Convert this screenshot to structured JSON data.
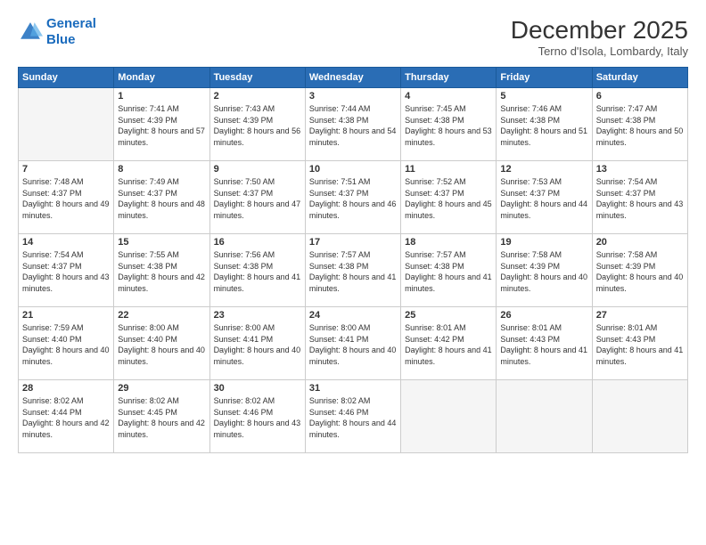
{
  "logo": {
    "line1": "General",
    "line2": "Blue"
  },
  "title": "December 2025",
  "location": "Terno d'Isola, Lombardy, Italy",
  "weekdays": [
    "Sunday",
    "Monday",
    "Tuesday",
    "Wednesday",
    "Thursday",
    "Friday",
    "Saturday"
  ],
  "weeks": [
    [
      {
        "day": "",
        "empty": true
      },
      {
        "day": "1",
        "sunrise": "7:41 AM",
        "sunset": "4:39 PM",
        "daylight": "8 hours and 57 minutes."
      },
      {
        "day": "2",
        "sunrise": "7:43 AM",
        "sunset": "4:39 PM",
        "daylight": "8 hours and 56 minutes."
      },
      {
        "day": "3",
        "sunrise": "7:44 AM",
        "sunset": "4:38 PM",
        "daylight": "8 hours and 54 minutes."
      },
      {
        "day": "4",
        "sunrise": "7:45 AM",
        "sunset": "4:38 PM",
        "daylight": "8 hours and 53 minutes."
      },
      {
        "day": "5",
        "sunrise": "7:46 AM",
        "sunset": "4:38 PM",
        "daylight": "8 hours and 51 minutes."
      },
      {
        "day": "6",
        "sunrise": "7:47 AM",
        "sunset": "4:38 PM",
        "daylight": "8 hours and 50 minutes."
      }
    ],
    [
      {
        "day": "7",
        "sunrise": "7:48 AM",
        "sunset": "4:37 PM",
        "daylight": "8 hours and 49 minutes."
      },
      {
        "day": "8",
        "sunrise": "7:49 AM",
        "sunset": "4:37 PM",
        "daylight": "8 hours and 48 minutes."
      },
      {
        "day": "9",
        "sunrise": "7:50 AM",
        "sunset": "4:37 PM",
        "daylight": "8 hours and 47 minutes."
      },
      {
        "day": "10",
        "sunrise": "7:51 AM",
        "sunset": "4:37 PM",
        "daylight": "8 hours and 46 minutes."
      },
      {
        "day": "11",
        "sunrise": "7:52 AM",
        "sunset": "4:37 PM",
        "daylight": "8 hours and 45 minutes."
      },
      {
        "day": "12",
        "sunrise": "7:53 AM",
        "sunset": "4:37 PM",
        "daylight": "8 hours and 44 minutes."
      },
      {
        "day": "13",
        "sunrise": "7:54 AM",
        "sunset": "4:37 PM",
        "daylight": "8 hours and 43 minutes."
      }
    ],
    [
      {
        "day": "14",
        "sunrise": "7:54 AM",
        "sunset": "4:37 PM",
        "daylight": "8 hours and 43 minutes."
      },
      {
        "day": "15",
        "sunrise": "7:55 AM",
        "sunset": "4:38 PM",
        "daylight": "8 hours and 42 minutes."
      },
      {
        "day": "16",
        "sunrise": "7:56 AM",
        "sunset": "4:38 PM",
        "daylight": "8 hours and 41 minutes."
      },
      {
        "day": "17",
        "sunrise": "7:57 AM",
        "sunset": "4:38 PM",
        "daylight": "8 hours and 41 minutes."
      },
      {
        "day": "18",
        "sunrise": "7:57 AM",
        "sunset": "4:38 PM",
        "daylight": "8 hours and 41 minutes."
      },
      {
        "day": "19",
        "sunrise": "7:58 AM",
        "sunset": "4:39 PM",
        "daylight": "8 hours and 40 minutes."
      },
      {
        "day": "20",
        "sunrise": "7:58 AM",
        "sunset": "4:39 PM",
        "daylight": "8 hours and 40 minutes."
      }
    ],
    [
      {
        "day": "21",
        "sunrise": "7:59 AM",
        "sunset": "4:40 PM",
        "daylight": "8 hours and 40 minutes."
      },
      {
        "day": "22",
        "sunrise": "8:00 AM",
        "sunset": "4:40 PM",
        "daylight": "8 hours and 40 minutes."
      },
      {
        "day": "23",
        "sunrise": "8:00 AM",
        "sunset": "4:41 PM",
        "daylight": "8 hours and 40 minutes."
      },
      {
        "day": "24",
        "sunrise": "8:00 AM",
        "sunset": "4:41 PM",
        "daylight": "8 hours and 40 minutes."
      },
      {
        "day": "25",
        "sunrise": "8:01 AM",
        "sunset": "4:42 PM",
        "daylight": "8 hours and 41 minutes."
      },
      {
        "day": "26",
        "sunrise": "8:01 AM",
        "sunset": "4:43 PM",
        "daylight": "8 hours and 41 minutes."
      },
      {
        "day": "27",
        "sunrise": "8:01 AM",
        "sunset": "4:43 PM",
        "daylight": "8 hours and 41 minutes."
      }
    ],
    [
      {
        "day": "28",
        "sunrise": "8:02 AM",
        "sunset": "4:44 PM",
        "daylight": "8 hours and 42 minutes."
      },
      {
        "day": "29",
        "sunrise": "8:02 AM",
        "sunset": "4:45 PM",
        "daylight": "8 hours and 42 minutes."
      },
      {
        "day": "30",
        "sunrise": "8:02 AM",
        "sunset": "4:46 PM",
        "daylight": "8 hours and 43 minutes."
      },
      {
        "day": "31",
        "sunrise": "8:02 AM",
        "sunset": "4:46 PM",
        "daylight": "8 hours and 44 minutes."
      },
      {
        "day": "",
        "empty": true
      },
      {
        "day": "",
        "empty": true
      },
      {
        "day": "",
        "empty": true
      }
    ]
  ]
}
